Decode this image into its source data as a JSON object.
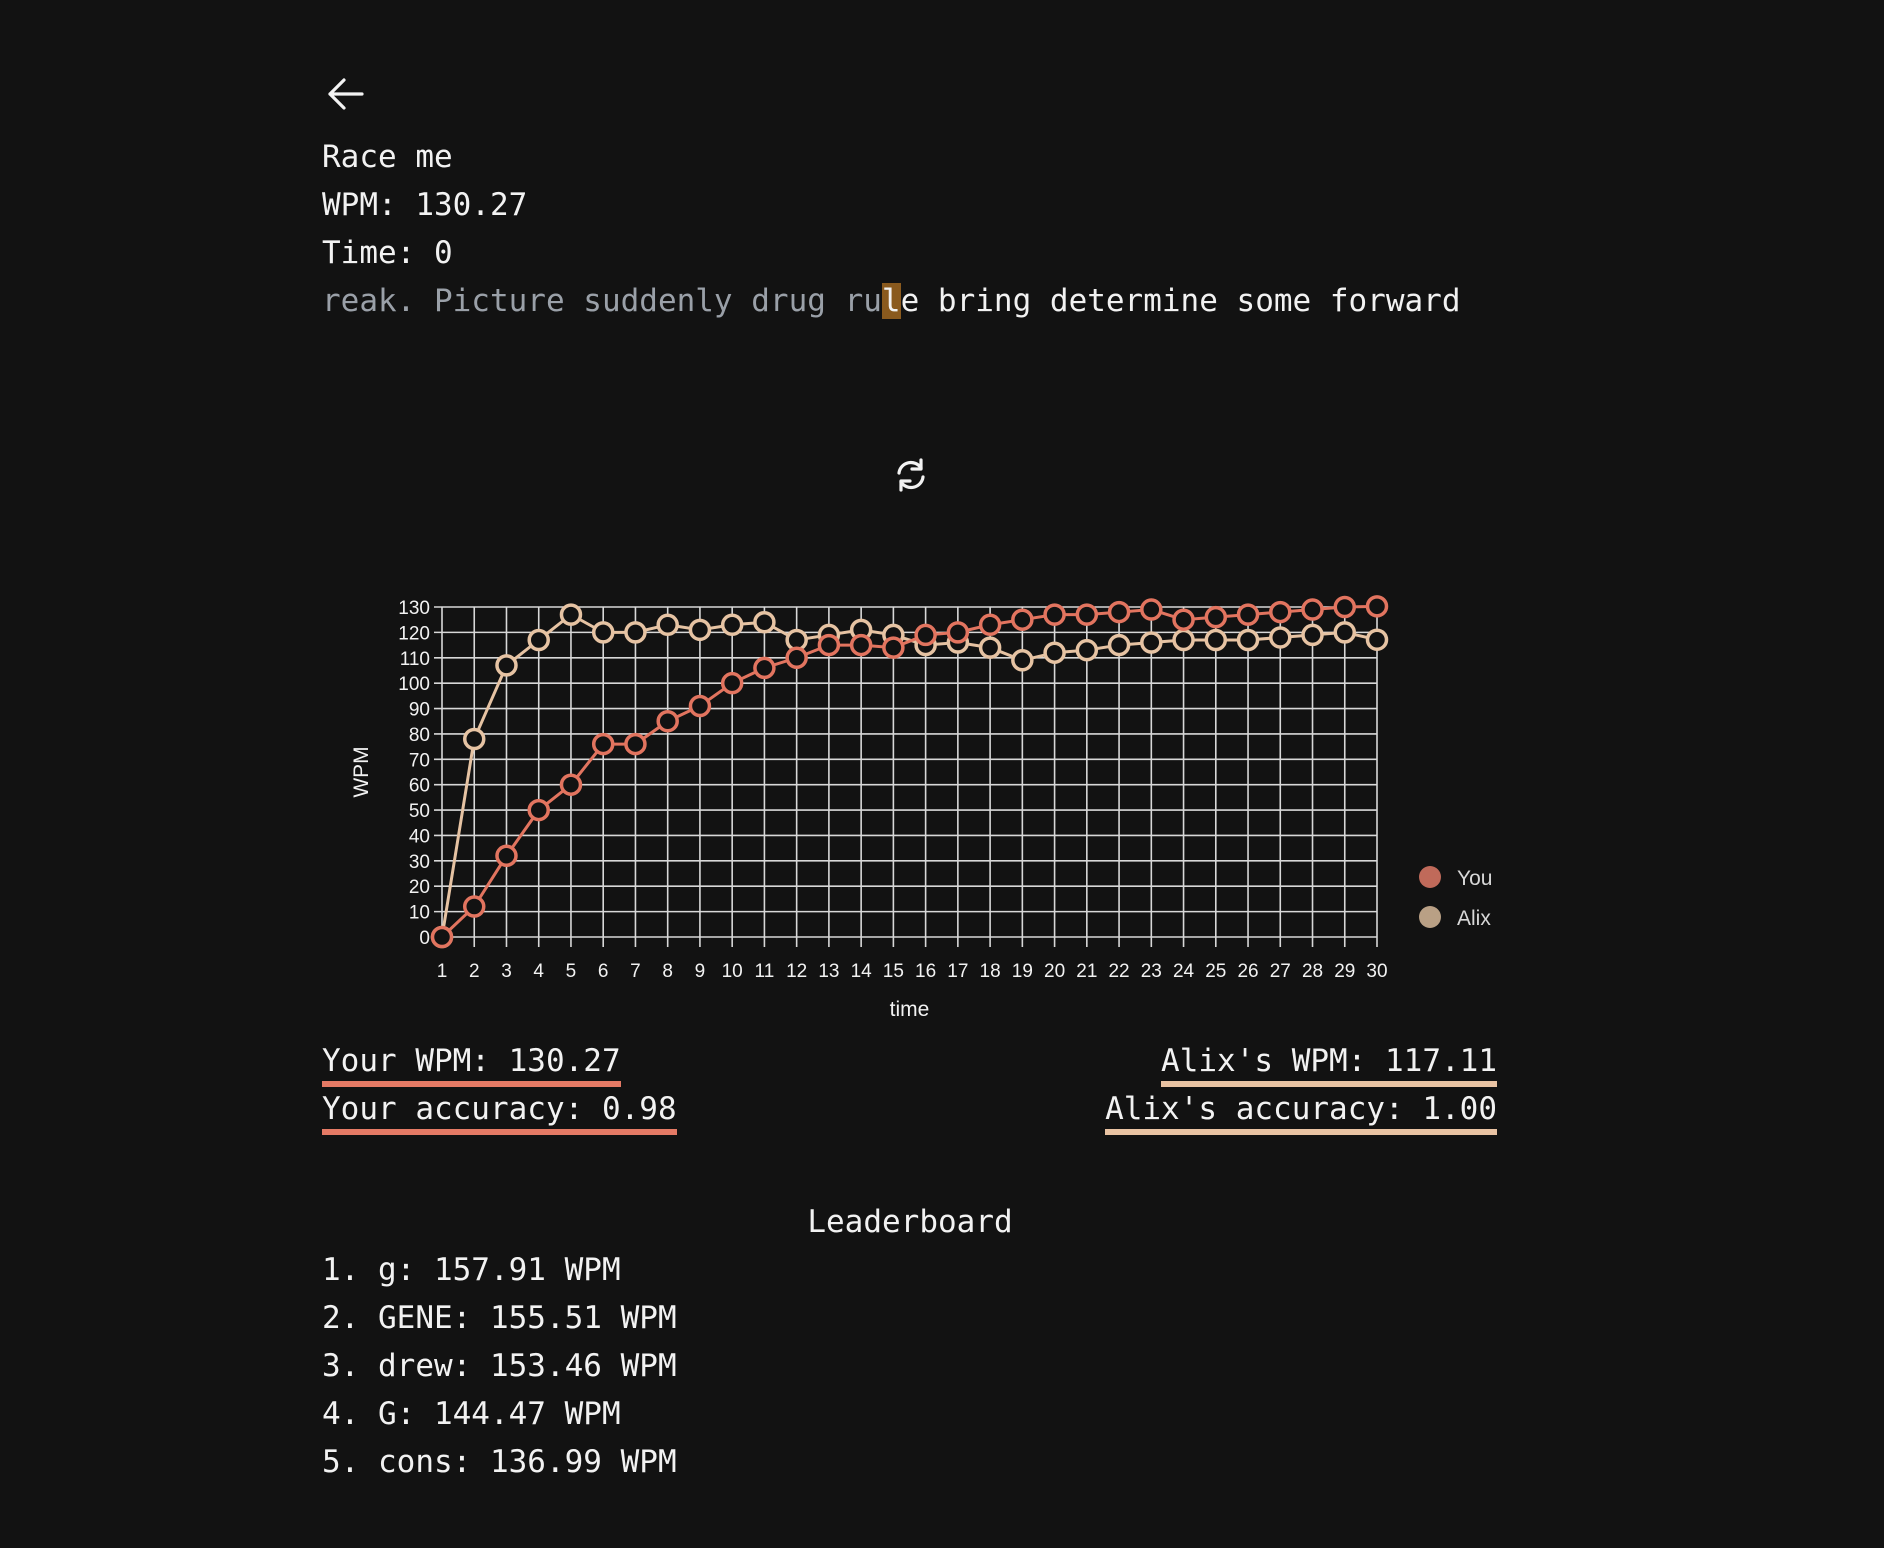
{
  "header": {
    "back_icon": "arrow-left-icon",
    "title": "Race me",
    "wpm_line": "WPM: 130.27",
    "time_line": "Time: 0"
  },
  "passage": {
    "typed": "reak. Picture suddenly drug ru",
    "cursor_char": "l",
    "pending": "e bring determine some forward"
  },
  "controls": {
    "restart_icon": "refresh-icon"
  },
  "chart_data": {
    "type": "line",
    "xlabel": "time",
    "ylabel": "WPM",
    "x": [
      1,
      2,
      3,
      4,
      5,
      6,
      7,
      8,
      9,
      10,
      11,
      12,
      13,
      14,
      15,
      16,
      17,
      18,
      19,
      20,
      21,
      22,
      23,
      24,
      25,
      26,
      27,
      28,
      29,
      30
    ],
    "yticks": [
      0,
      10,
      20,
      30,
      40,
      50,
      60,
      70,
      80,
      90,
      100,
      110,
      120,
      130
    ],
    "ylim": [
      0,
      130
    ],
    "grid": true,
    "legend_placement": "right",
    "series": [
      {
        "name": "You",
        "color": "#e2745f",
        "legend_color": "#c06a5a",
        "values": [
          0,
          12,
          32,
          50,
          60,
          76,
          76,
          85,
          91,
          100,
          106,
          110,
          115,
          115,
          114,
          119,
          120,
          123,
          125,
          127,
          127,
          128,
          129,
          125,
          126,
          127,
          128,
          129,
          130,
          130.27
        ]
      },
      {
        "name": "Alix",
        "color": "#e6c3a3",
        "legend_color": "#b9a085",
        "values": [
          0,
          78,
          107,
          117,
          127,
          120,
          120,
          123,
          121,
          123,
          124,
          117,
          119,
          121,
          119,
          115,
          116,
          114,
          109,
          112,
          113,
          115,
          116,
          117,
          117,
          117,
          118,
          119,
          120,
          117.11
        ]
      }
    ]
  },
  "results": {
    "you_wpm": "Your WPM: 130.27",
    "you_accuracy": "Your accuracy: 0.98",
    "alix_wpm": "Alix's WPM: 117.11",
    "alix_accuracy": "Alix's accuracy: 1.00"
  },
  "leaderboard": {
    "title": "Leaderboard",
    "entries": [
      "1. g: 157.91 WPM",
      "2. GENE: 155.51 WPM",
      "3. drew: 153.46 WPM",
      "4. G: 144.47 WPM",
      "5. cons: 136.99 WPM"
    ]
  }
}
